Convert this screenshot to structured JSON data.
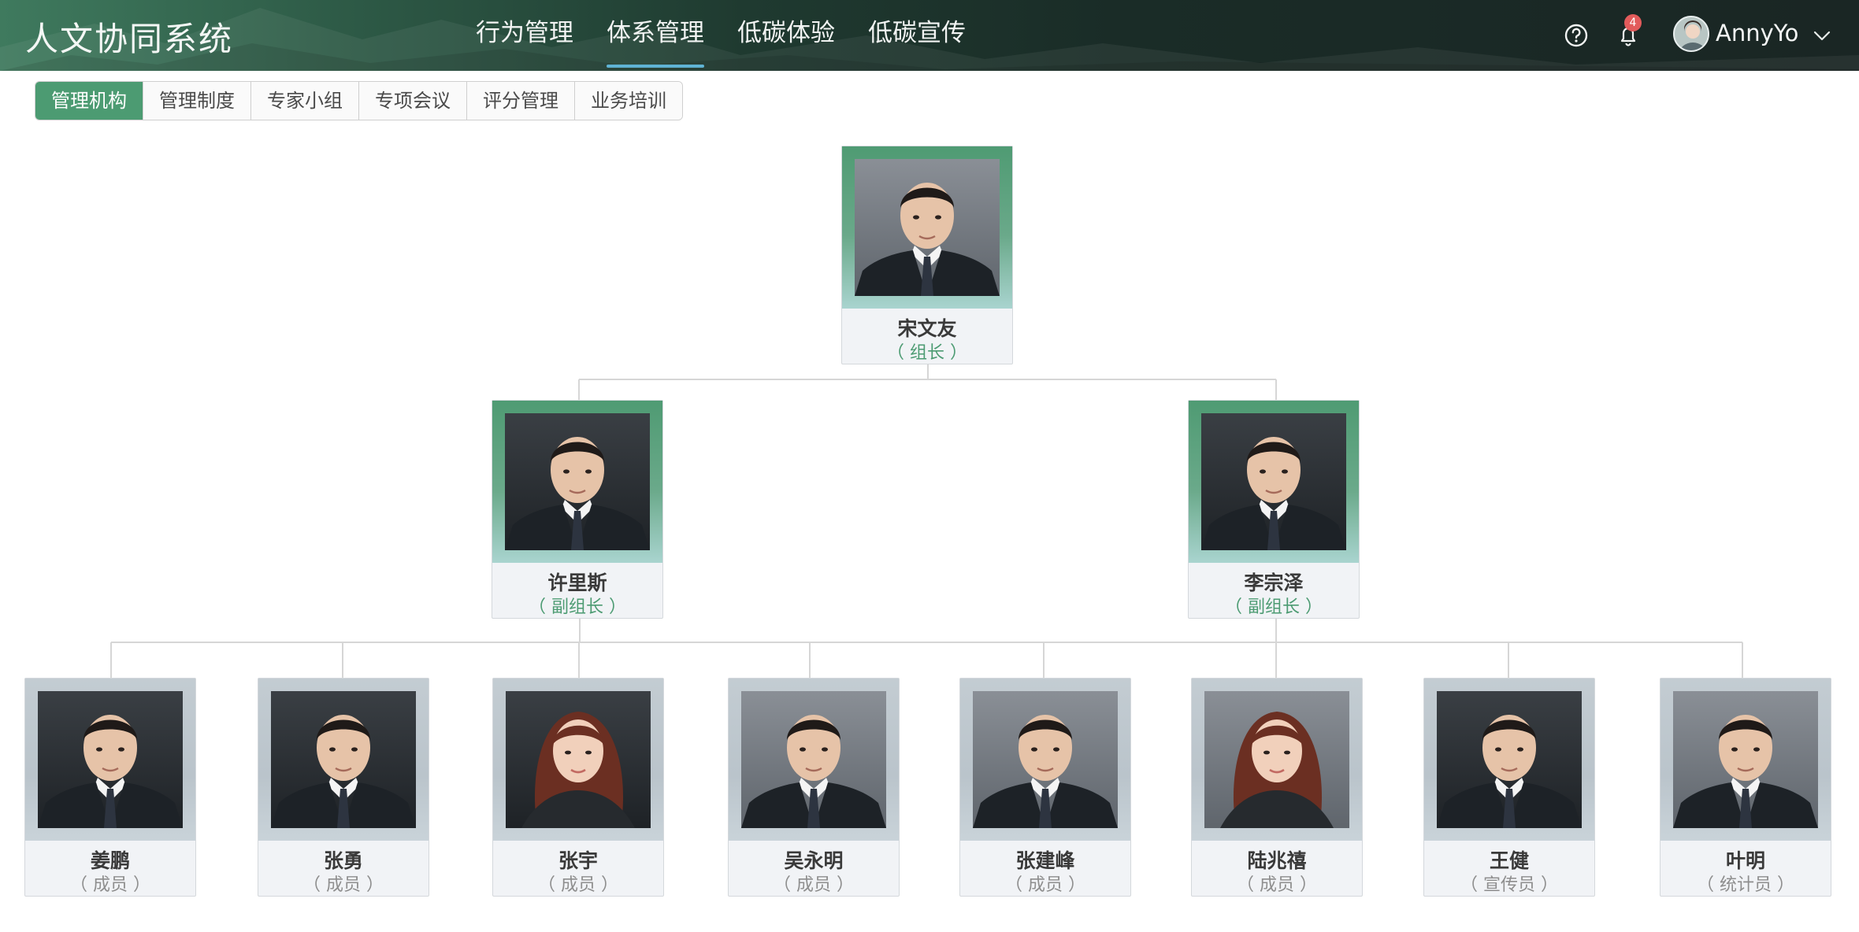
{
  "header": {
    "app_title": "人文协同系统",
    "nav": [
      {
        "label": "行为管理",
        "active": false
      },
      {
        "label": "体系管理",
        "active": true
      },
      {
        "label": "低碳体验",
        "active": false
      },
      {
        "label": "低碳宣传",
        "active": false
      }
    ],
    "notification_count": "4",
    "user_name": "AnnyYo",
    "icons": [
      "help-circle-icon",
      "bell-icon",
      "avatar",
      "chevron-down-icon"
    ]
  },
  "subtabs": [
    {
      "label": "管理机构",
      "active": true
    },
    {
      "label": "管理制度",
      "active": false
    },
    {
      "label": "专家小组",
      "active": false
    },
    {
      "label": "专项会议",
      "active": false
    },
    {
      "label": "评分管理",
      "active": false
    },
    {
      "label": "业务培训",
      "active": false
    }
  ],
  "org": {
    "head": {
      "name": "宋文友",
      "role": "（ 组长 ）"
    },
    "deputies": [
      {
        "name": "许里斯",
        "role": "（ 副组长 ）"
      },
      {
        "name": "李宗泽",
        "role": "（ 副组长 ）"
      }
    ],
    "members": [
      {
        "name": "姜鹏",
        "role": "（ 成员 ）"
      },
      {
        "name": "张勇",
        "role": "（ 成员 ）"
      },
      {
        "name": "张宇",
        "role": "（ 成员 ）"
      },
      {
        "name": "吴永明",
        "role": "（ 成员 ）"
      },
      {
        "name": "张建峰",
        "role": "（ 成员 ）"
      },
      {
        "name": "陆兆禧",
        "role": "（ 成员 ）"
      },
      {
        "name": "王健",
        "role": "（ 宣传员 ）"
      },
      {
        "name": "叶明",
        "role": "（ 统计员 ）"
      }
    ]
  },
  "colors": {
    "accent_green": "#4c9b72",
    "header_dark": "#1a2624",
    "badge_red": "#e25b5b",
    "tab_underline": "#5fb3d4"
  }
}
